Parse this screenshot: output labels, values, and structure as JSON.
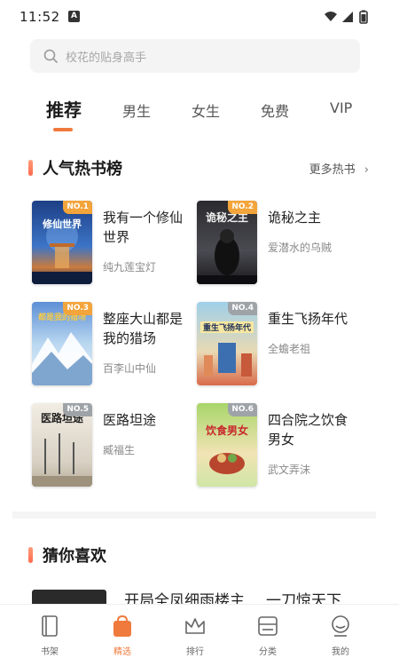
{
  "status_bar": {
    "time": "11:52",
    "notif": "A"
  },
  "search": {
    "placeholder": "校花的贴身高手"
  },
  "tabs": [
    {
      "label": "推荐",
      "active": true
    },
    {
      "label": "男生"
    },
    {
      "label": "女生"
    },
    {
      "label": "免费"
    },
    {
      "label": "VIP"
    }
  ],
  "hot_section": {
    "title": "人气热书榜",
    "more": "更多热书"
  },
  "books": [
    {
      "rank": "NO.1",
      "title": "我有一个修仙世界",
      "author": "纯九莲宝灯",
      "cover_text": "修仙世界"
    },
    {
      "rank": "NO.2",
      "title": "诡秘之主",
      "author": "爱潜水的乌贼",
      "cover_text": "诡秘之主"
    },
    {
      "rank": "NO.3",
      "title": "整座大山都是我的猎场",
      "author": "百李山中仙",
      "cover_text": "都是我的猎场"
    },
    {
      "rank": "NO.4",
      "title": "重生飞扬年代",
      "author": "全蟾老祖",
      "cover_text": "重生飞扬年代"
    },
    {
      "rank": "NO.5",
      "title": "医路坦途",
      "author": "臧福生",
      "cover_text": "医路坦途"
    },
    {
      "rank": "NO.6",
      "title": "四合院之饮食男女",
      "author": "武文弄沫",
      "cover_text": "饮食男女"
    }
  ],
  "guess_section": {
    "title": "猜你喜欢",
    "peek_left": "开局全凤细雨楼主",
    "peek_right": "一刀惊天下"
  },
  "bottom_nav": [
    {
      "label": "书架",
      "icon": "bookshelf-icon"
    },
    {
      "label": "精选",
      "icon": "featured-icon",
      "active": true
    },
    {
      "label": "排行",
      "icon": "crown-icon"
    },
    {
      "label": "分类",
      "icon": "category-icon"
    },
    {
      "label": "我的",
      "icon": "profile-icon"
    }
  ],
  "colors": {
    "accent": "#f07a3d",
    "rank_gold": "#f3a43a",
    "rank_silver": "#9ea3a8"
  }
}
